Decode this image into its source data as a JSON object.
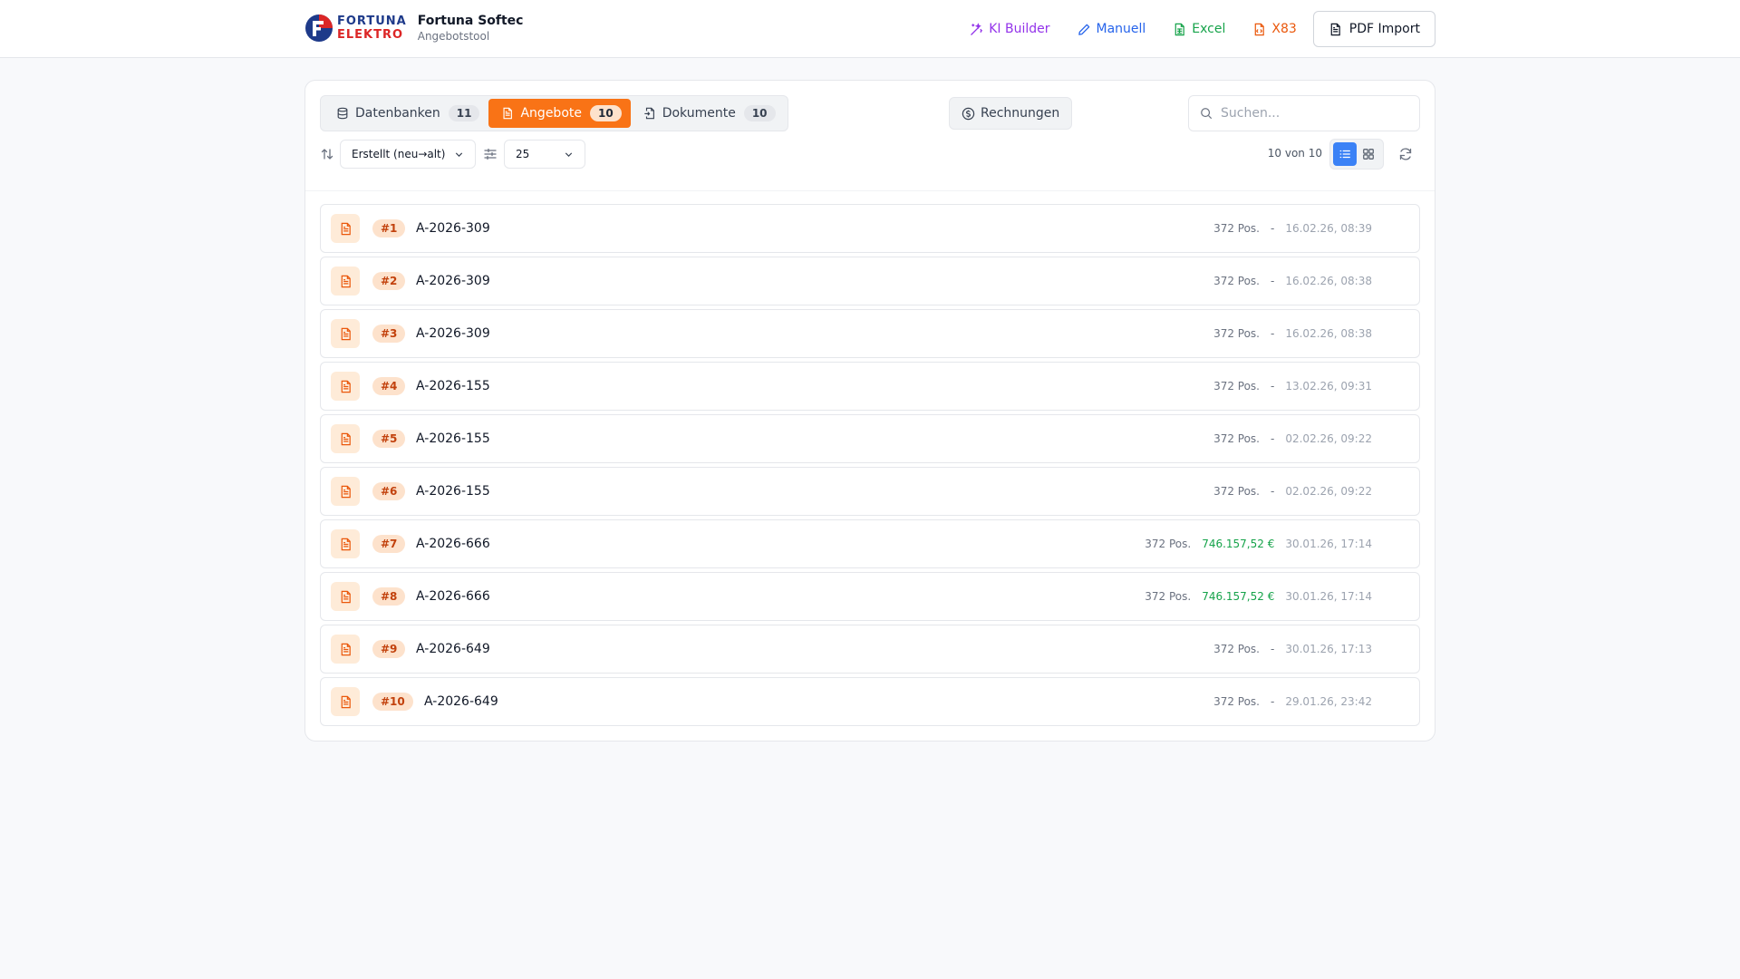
{
  "header": {
    "logo_line1": "FORTUNA",
    "logo_line2": "ELEKTRO",
    "title": "Fortuna Softec",
    "subtitle": "Angebotstool",
    "nav": {
      "ki_builder": "KI Builder",
      "manuell": "Manuell",
      "excel": "Excel",
      "x83": "X83",
      "pdf_import": "PDF Import"
    }
  },
  "tabs": [
    {
      "label": "Datenbanken",
      "count": "11"
    },
    {
      "label": "Angebote",
      "count": "10"
    },
    {
      "label": "Dokumente",
      "count": "10"
    }
  ],
  "invoices_button": "Rechnungen",
  "search": {
    "placeholder": "Suchen..."
  },
  "sort": {
    "selected": "Erstellt (neu→alt)"
  },
  "page_size": {
    "selected": "25"
  },
  "result_count": "10 von 10",
  "colors": {
    "accent": "#f97316",
    "active_view": "#3b82f6",
    "price": "#16a34a",
    "badge_text": "#c2410c"
  },
  "rows": [
    {
      "num": "#1",
      "title": "A-2026-309",
      "positions": "372 Pos.",
      "price": "-",
      "date": "16.02.26, 08:39"
    },
    {
      "num": "#2",
      "title": "A-2026-309",
      "positions": "372 Pos.",
      "price": "-",
      "date": "16.02.26, 08:38"
    },
    {
      "num": "#3",
      "title": "A-2026-309",
      "positions": "372 Pos.",
      "price": "-",
      "date": "16.02.26, 08:38"
    },
    {
      "num": "#4",
      "title": "A-2026-155",
      "positions": "372 Pos.",
      "price": "-",
      "date": "13.02.26, 09:31"
    },
    {
      "num": "#5",
      "title": "A-2026-155",
      "positions": "372 Pos.",
      "price": "-",
      "date": "02.02.26, 09:22"
    },
    {
      "num": "#6",
      "title": "A-2026-155",
      "positions": "372 Pos.",
      "price": "-",
      "date": "02.02.26, 09:22"
    },
    {
      "num": "#7",
      "title": "A-2026-666",
      "positions": "372 Pos.",
      "price": "746.157,52 €",
      "date": "30.01.26, 17:14"
    },
    {
      "num": "#8",
      "title": "A-2026-666",
      "positions": "372 Pos.",
      "price": "746.157,52 €",
      "date": "30.01.26, 17:14"
    },
    {
      "num": "#9",
      "title": "A-2026-649",
      "positions": "372 Pos.",
      "price": "-",
      "date": "30.01.26, 17:13"
    },
    {
      "num": "#10",
      "title": "A-2026-649",
      "positions": "372 Pos.",
      "price": "-",
      "date": "29.01.26, 23:42"
    }
  ]
}
